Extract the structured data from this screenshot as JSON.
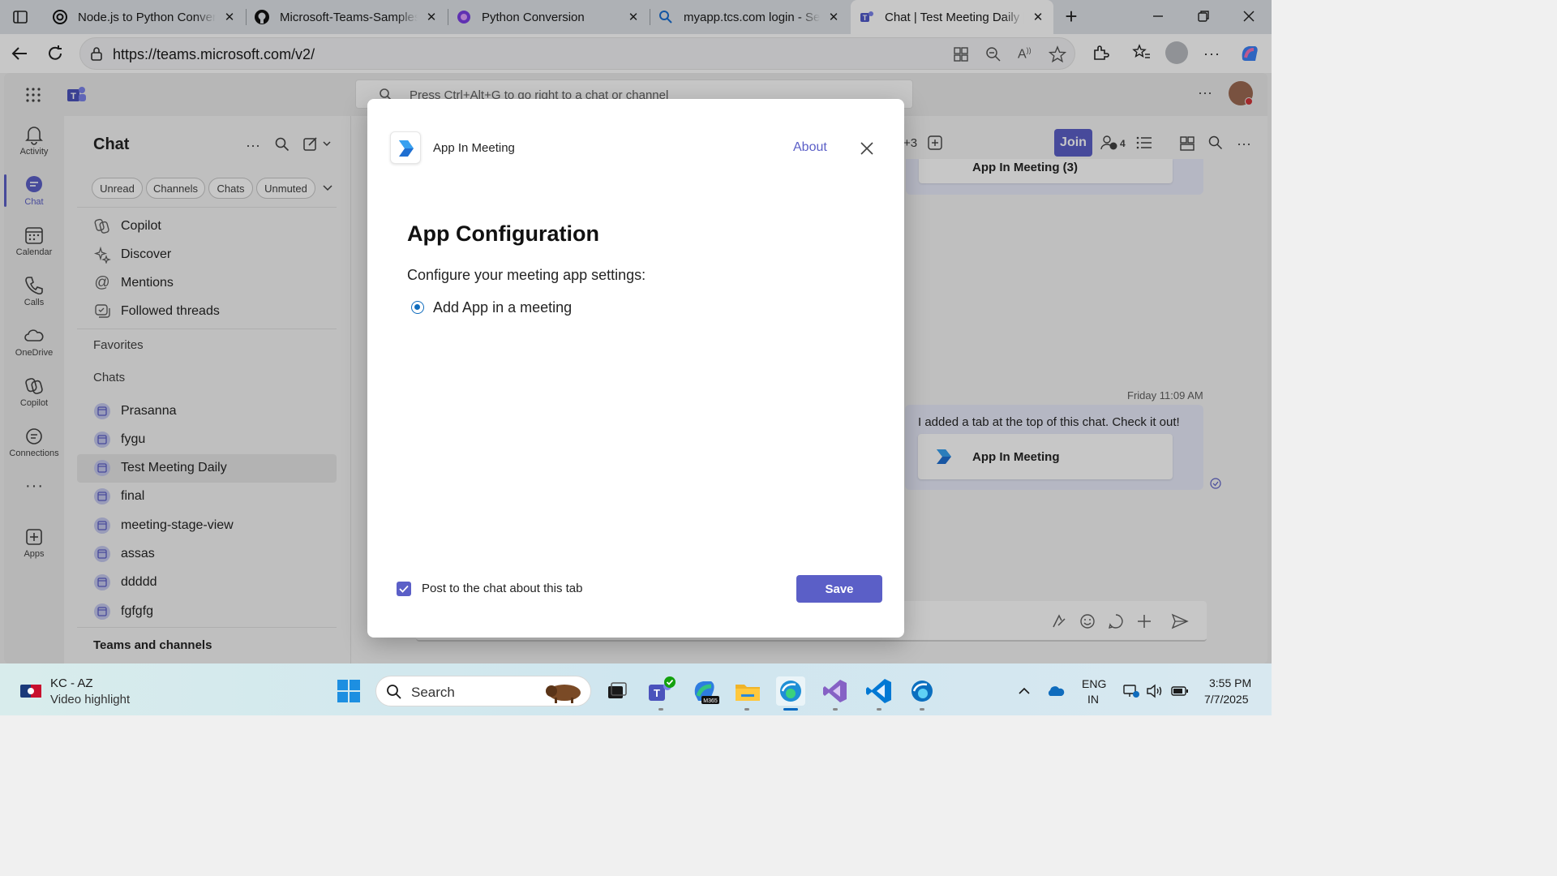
{
  "browser": {
    "tabs": [
      {
        "label": "Node.js to Python Conversion",
        "icon": "openai-icon"
      },
      {
        "label": "Microsoft-Teams-Samples/",
        "icon": "github-icon"
      },
      {
        "label": "Python Conversion",
        "icon": "copilot-icon"
      },
      {
        "label": "myapp.tcs.com login - Search",
        "icon": "search-icon"
      },
      {
        "label": "Chat | Test Meeting Daily | Microsoft Teams",
        "icon": "teams-icon",
        "active": true
      }
    ],
    "url": "https://teams.microsoft.com/v2/"
  },
  "teams": {
    "search_placeholder": "Press Ctrl+Alt+G to go right to a chat or channel",
    "rail": [
      {
        "label": "Activity",
        "icon": "bell-icon"
      },
      {
        "label": "Chat",
        "icon": "chat-icon",
        "active": true
      },
      {
        "label": "Calendar",
        "icon": "calendar-icon"
      },
      {
        "label": "Calls",
        "icon": "phone-icon"
      },
      {
        "label": "OneDrive",
        "icon": "cloud-icon"
      },
      {
        "label": "Copilot",
        "icon": "copilot-icon"
      },
      {
        "label": "Connections",
        "icon": "connections-icon"
      },
      {
        "label": "Apps",
        "icon": "apps-icon"
      }
    ],
    "chat_panel": {
      "title": "Chat",
      "filters": [
        "Unread",
        "Channels",
        "Chats",
        "Unmuted"
      ],
      "pinned": [
        "Copilot",
        "Discover",
        "Mentions",
        "Followed threads"
      ],
      "favorites_label": "Favorites",
      "chats_label": "Chats",
      "chats": [
        "Prasanna",
        "fygu",
        "Test Meeting Daily",
        "final",
        "meeting-stage-view",
        "assas",
        "ddddd",
        "fgfgfg"
      ],
      "selected_chat": "Test Meeting Daily",
      "teams_label": "Teams and channels"
    },
    "header": {
      "participants_extra": "+3",
      "join_label": "Join",
      "people_count": "4"
    },
    "conversation": {
      "top_card_title": "App In Meeting (3)",
      "timestamp": "Friday 11:09 AM",
      "message": "I added a tab at the top of this chat. Check it out!",
      "card_title": "App In Meeting"
    }
  },
  "dialog": {
    "app_name": "App In Meeting",
    "about_label": "About",
    "heading": "App Configuration",
    "subheading": "Configure your meeting app settings:",
    "radio_label": "Add App in a meeting",
    "checkbox_label": "Post to the chat about this tab",
    "save_label": "Save",
    "accent": "#5b5fc7"
  },
  "taskbar": {
    "weather_title": "KC - AZ",
    "weather_sub": "Video highlight",
    "search_label": "Search",
    "lang_line1": "ENG",
    "lang_line2": "IN",
    "time": "3:55 PM",
    "date": "7/7/2025"
  }
}
